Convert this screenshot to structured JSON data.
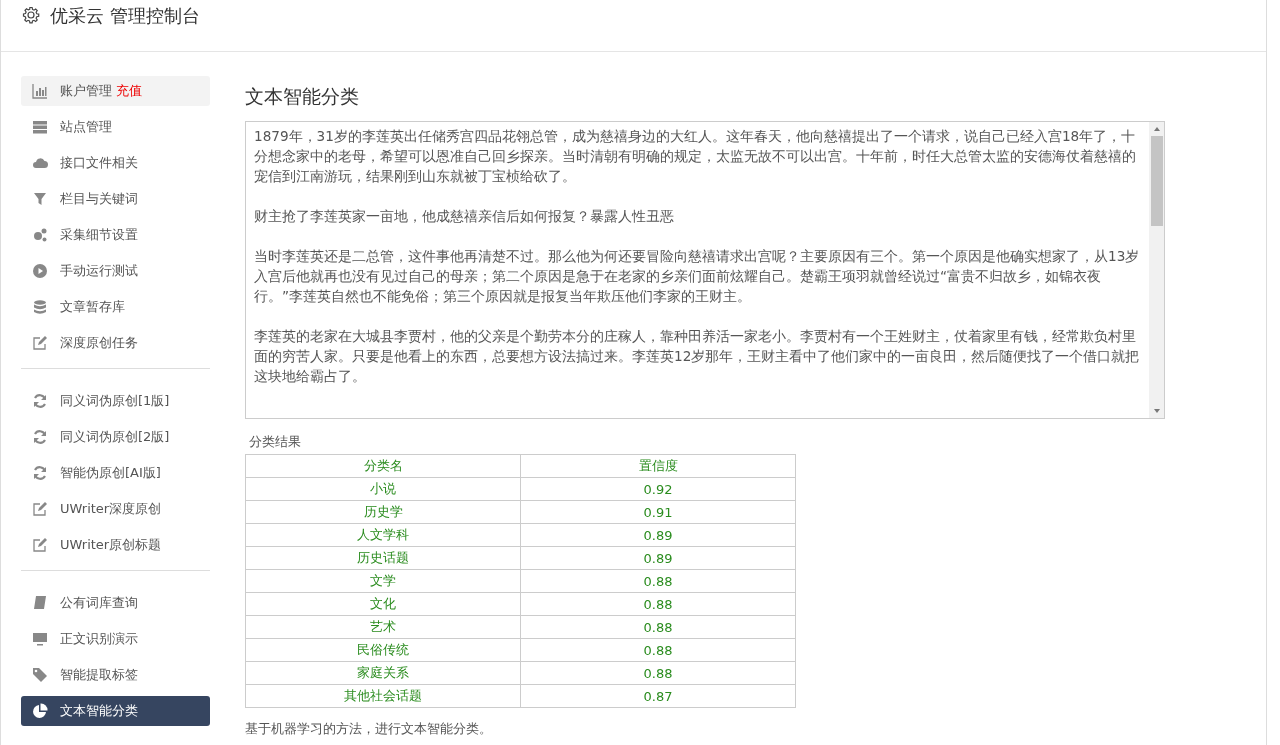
{
  "header": {
    "title": "优采云 管理控制台"
  },
  "sidebar": {
    "groups": [
      [
        {
          "label": "账户管理",
          "badge": "充值",
          "kind": "chart",
          "selected": false,
          "highlighted": true
        },
        {
          "label": "站点管理",
          "kind": "server",
          "selected": false,
          "highlighted": false
        },
        {
          "label": "接口文件相关",
          "kind": "cloud",
          "selected": false,
          "highlighted": false
        },
        {
          "label": "栏目与关键词",
          "kind": "filter",
          "selected": false,
          "highlighted": false
        },
        {
          "label": "采集细节设置",
          "kind": "gears",
          "selected": false,
          "highlighted": false
        },
        {
          "label": "手动运行测试",
          "kind": "play",
          "selected": false,
          "highlighted": false
        },
        {
          "label": "文章暂存库",
          "kind": "database",
          "selected": false,
          "highlighted": false
        },
        {
          "label": "深度原创任务",
          "kind": "edit",
          "selected": false,
          "highlighted": false
        }
      ],
      [
        {
          "label": "同义词伪原创[1版]",
          "kind": "refresh",
          "selected": false,
          "highlighted": false
        },
        {
          "label": "同义词伪原创[2版]",
          "kind": "refresh",
          "selected": false,
          "highlighted": false
        },
        {
          "label": "智能伪原创[AI版]",
          "kind": "refresh",
          "selected": false,
          "highlighted": false
        },
        {
          "label": "UWriter深度原创",
          "kind": "edit",
          "selected": false,
          "highlighted": false
        },
        {
          "label": "UWriter原创标题",
          "kind": "edit",
          "selected": false,
          "highlighted": false
        }
      ],
      [
        {
          "label": "公有词库查询",
          "kind": "book",
          "selected": false,
          "highlighted": false
        },
        {
          "label": "正文识别演示",
          "kind": "monitor",
          "selected": false,
          "highlighted": false
        },
        {
          "label": "智能提取标签",
          "kind": "tag",
          "selected": false,
          "highlighted": false
        },
        {
          "label": "文本智能分类",
          "kind": "pie",
          "selected": true,
          "highlighted": false
        }
      ]
    ]
  },
  "main": {
    "heading": "文本智能分类",
    "text_area": {
      "paragraphs": [
        "1879年，31岁的李莲英出任储秀宫四品花翎总管，成为慈禧身边的大红人。这年春天，他向慈禧提出了一个请求，说自己已经入宫18年了，十分想念家中的老母，希望可以恩准自己回乡探亲。当时清朝有明确的规定，太监无故不可以出宫。十年前，时任大总管太监的安德海仗着慈禧的宠信到江南游玩，结果刚到山东就被丁宝桢给砍了。",
        "财主抢了李莲英家一亩地，他成慈禧亲信后如何报复？暴露人性丑恶",
        "当时李莲英还是二总管，这件事他再清楚不过。那么他为何还要冒险向慈禧请求出宫呢？主要原因有三个。第一个原因是他确实想家了，从13岁入宫后他就再也没有见过自己的母亲；第二个原因是急于在老家的乡亲们面前炫耀自己。楚霸王项羽就曾经说过“富贵不归故乡，如锦衣夜行。”李莲英自然也不能免俗；第三个原因就是报复当年欺压他们李家的王财主。",
        "李莲英的老家在大城县李贾村，他的父亲是个勤劳本分的庄稼人，靠种田养活一家老小。李贾村有一个王姓财主，仗着家里有钱，经常欺负村里面的穷苦人家。只要是他看上的东西，总要想方设法搞过来。李莲英12岁那年，王财主看中了他们家中的一亩良田，然后随便找了一个借口就把这块地给霸占了。"
      ]
    },
    "result_caption": "分类结果",
    "table": {
      "columns": [
        "分类名",
        "置信度"
      ],
      "rows": [
        [
          "小说",
          "0.92"
        ],
        [
          "历史学",
          "0.91"
        ],
        [
          "人文学科",
          "0.89"
        ],
        [
          "历史话题",
          "0.89"
        ],
        [
          "文学",
          "0.88"
        ],
        [
          "文化",
          "0.88"
        ],
        [
          "艺术",
          "0.88"
        ],
        [
          "民俗传统",
          "0.88"
        ],
        [
          "家庭关系",
          "0.88"
        ],
        [
          "其他社会话题",
          "0.87"
        ]
      ]
    },
    "footnote": "基于机器学习的方法，进行文本智能分类。"
  }
}
